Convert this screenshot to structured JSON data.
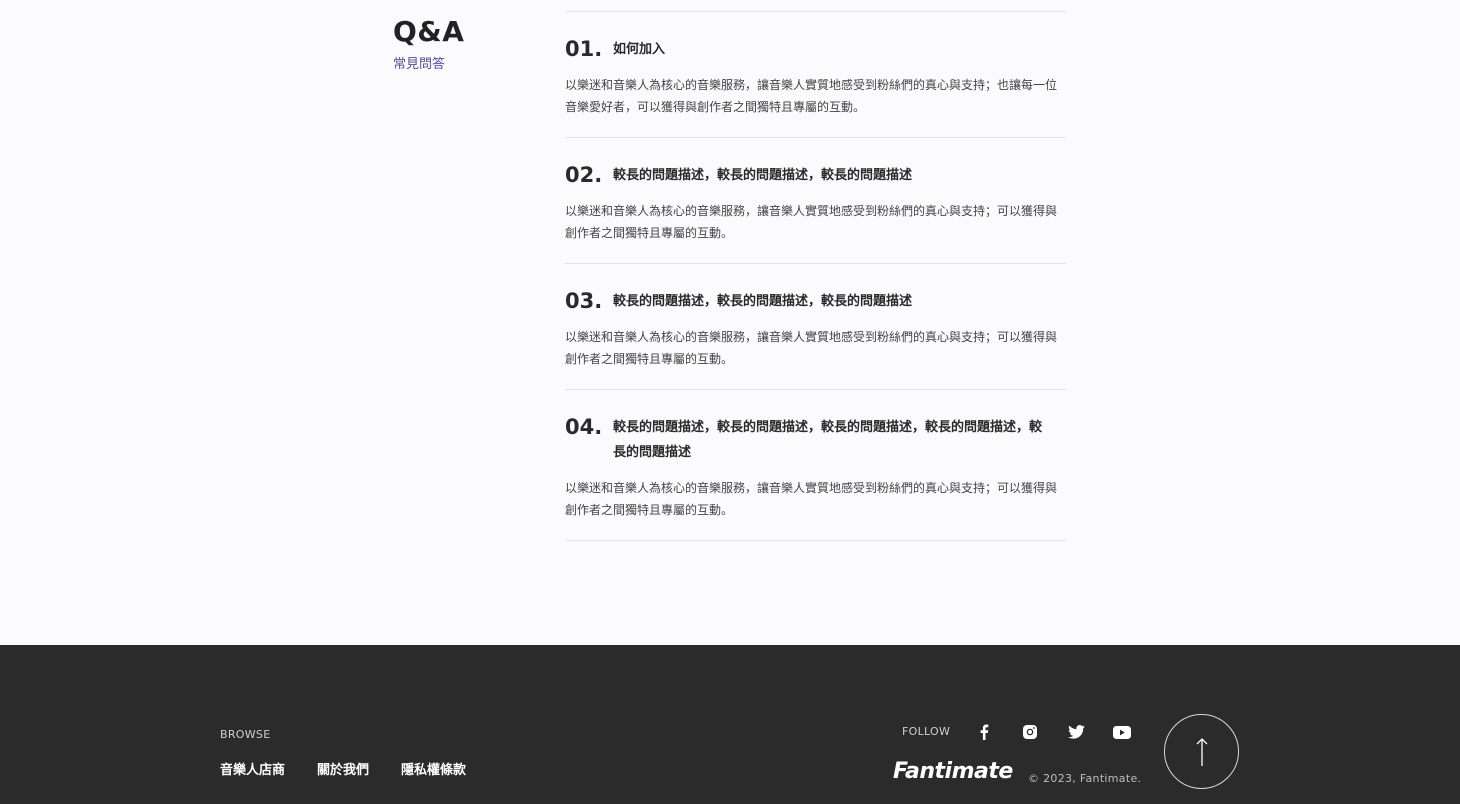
{
  "section": {
    "title": "Q&A",
    "subtitle": "常見問答"
  },
  "faq": [
    {
      "num": "01.",
      "question": "如何加入",
      "answer": "以樂迷和音樂人為核心的音樂服務，讓音樂人實質地感受到粉絲們的真心與支持；也讓每一位音樂愛好者，可以獲得與創作者之間獨特且專屬的互動。"
    },
    {
      "num": "02.",
      "question": "較長的問題描述，較長的問題描述，較長的問題描述",
      "answer": "以樂迷和音樂人為核心的音樂服務，讓音樂人實質地感受到粉絲們的真心與支持；可以獲得與創作者之間獨特且專屬的互動。"
    },
    {
      "num": "03.",
      "question": "較長的問題描述，較長的問題描述，較長的問題描述",
      "answer": "以樂迷和音樂人為核心的音樂服務，讓音樂人實質地感受到粉絲們的真心與支持；可以獲得與創作者之間獨特且專屬的互動。"
    },
    {
      "num": "04.",
      "question": "較長的問題描述，較長的問題描述，較長的問題描述，較長的問題描述，較長的問題描述",
      "answer": "以樂迷和音樂人為核心的音樂服務，讓音樂人實質地感受到粉絲們的真心與支持；可以獲得與創作者之間獨特且專屬的互動。"
    }
  ],
  "footer": {
    "browse_label": "BROWSE",
    "links": [
      "音樂人店商",
      "關於我們",
      "隱私權條款"
    ],
    "follow_label": "FOLLOW",
    "social_icons": [
      "facebook-icon",
      "instagram-icon",
      "twitter-icon",
      "youtube-icon"
    ],
    "brand": "Fantimate",
    "copyright": "© 2023, Fantimate.",
    "back_to_top_icon": "arrow-up-icon"
  },
  "colors": {
    "accent": "#5b4a9a",
    "footer_bg": "#2b2b2b",
    "page_bg": "#fbfbfd"
  }
}
